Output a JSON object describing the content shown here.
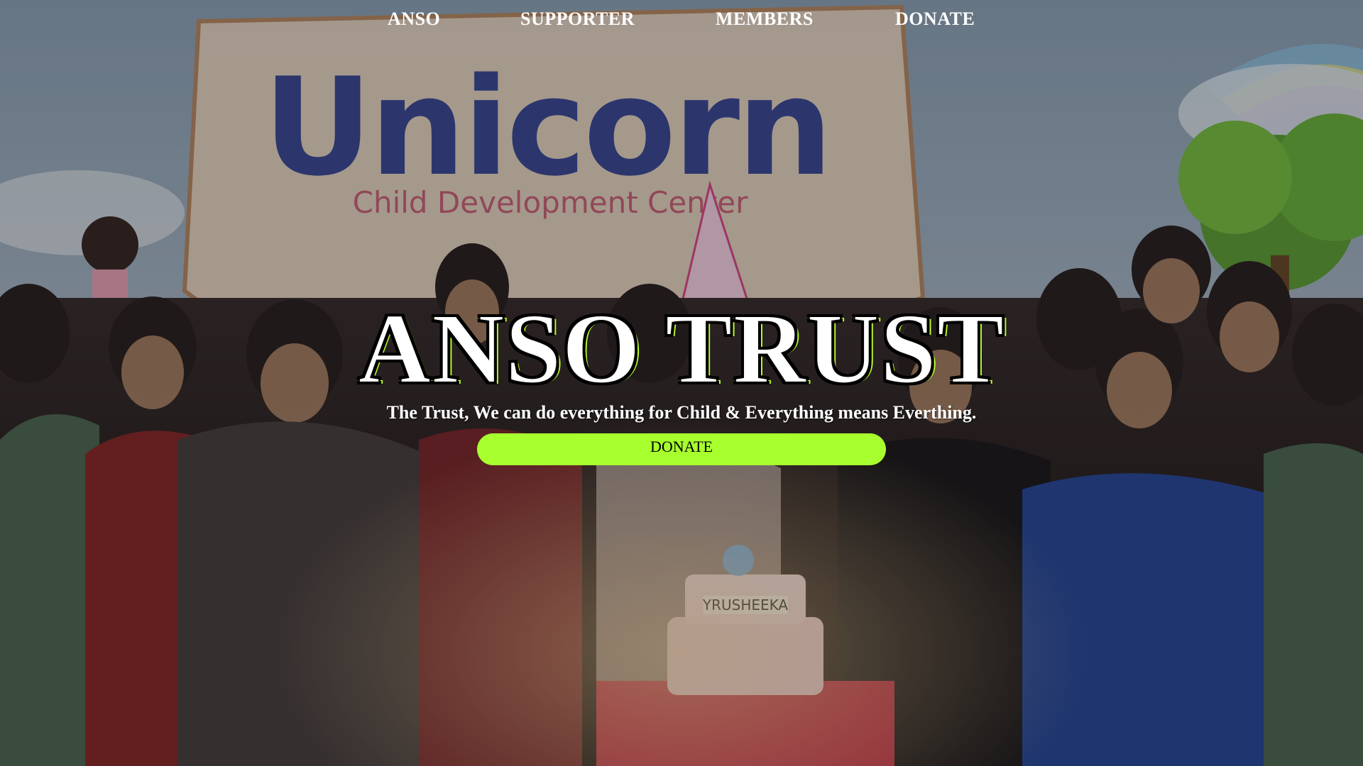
{
  "nav": {
    "items": [
      {
        "label": "ANSO"
      },
      {
        "label": "SUPPORTER"
      },
      {
        "label": "MEMBERS"
      },
      {
        "label": "DONATE"
      }
    ]
  },
  "hero": {
    "background_image": "photo of children clapping around a birthday cake in front of a Unicorn Child Development Center banner",
    "banner_text": {
      "name": "Unicorn",
      "subtitle": "Child Development Center"
    },
    "cake_text": "YRUSHEEKA",
    "title": "ANSO TRUST",
    "tagline": "The Trust, We can do everything for Child & Everything means Everthing.",
    "donate_label": "DONATE"
  },
  "colors": {
    "accent": "#a8ff2e",
    "title_outline": "#b8ff2e",
    "nav_text": "#ffffff"
  }
}
